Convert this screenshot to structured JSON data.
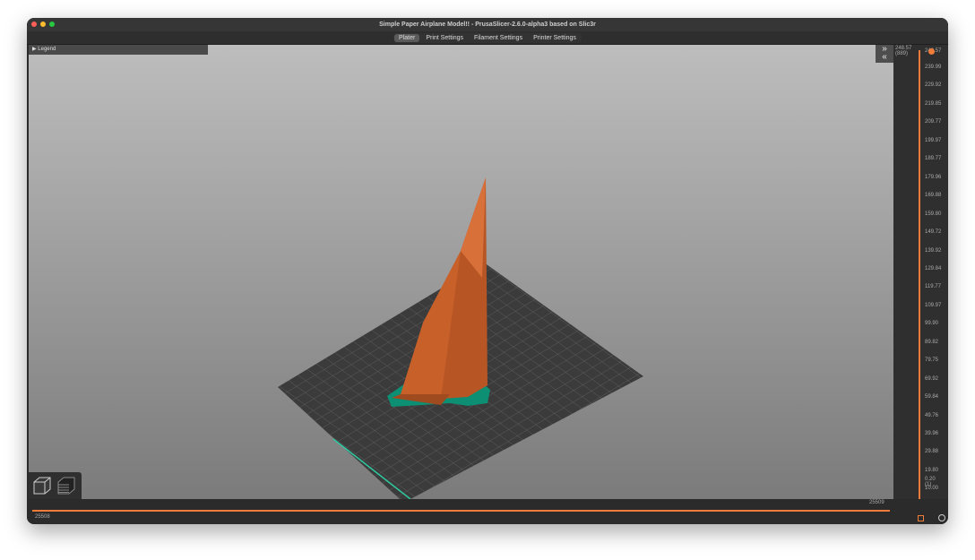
{
  "window": {
    "title": "Simple Paper Airplane Model!! - PrusaSlicer-2.6.0-alpha3 based on Slic3r"
  },
  "tabs": [
    "Plater",
    "Print Settings",
    "Filament Settings",
    "Printer Settings"
  ],
  "legend": {
    "label": "Legend"
  },
  "vertical_slider": {
    "top_value": "248.57",
    "top_layer": "(889)",
    "top_handle_label": "248.57",
    "bottom_value": "0.20",
    "bottom_layer": "(1)",
    "ticks": [
      "239.99",
      "229.92",
      "219.85",
      "209.77",
      "199.97",
      "189.77",
      "179.96",
      "169.88",
      "159.80",
      "149.72",
      "139.92",
      "129.84",
      "119.77",
      "109.97",
      "99.90",
      "89.82",
      "79.75",
      "69.92",
      "59.84",
      "49.76",
      "39.96",
      "29.88",
      "19.80",
      "10.00"
    ]
  },
  "horizontal_slider": {
    "left_value": "25508",
    "right_value": "25509"
  },
  "colors": {
    "accent": "#f07c3a",
    "model": "#c8602a",
    "support": "#0d8f74"
  }
}
